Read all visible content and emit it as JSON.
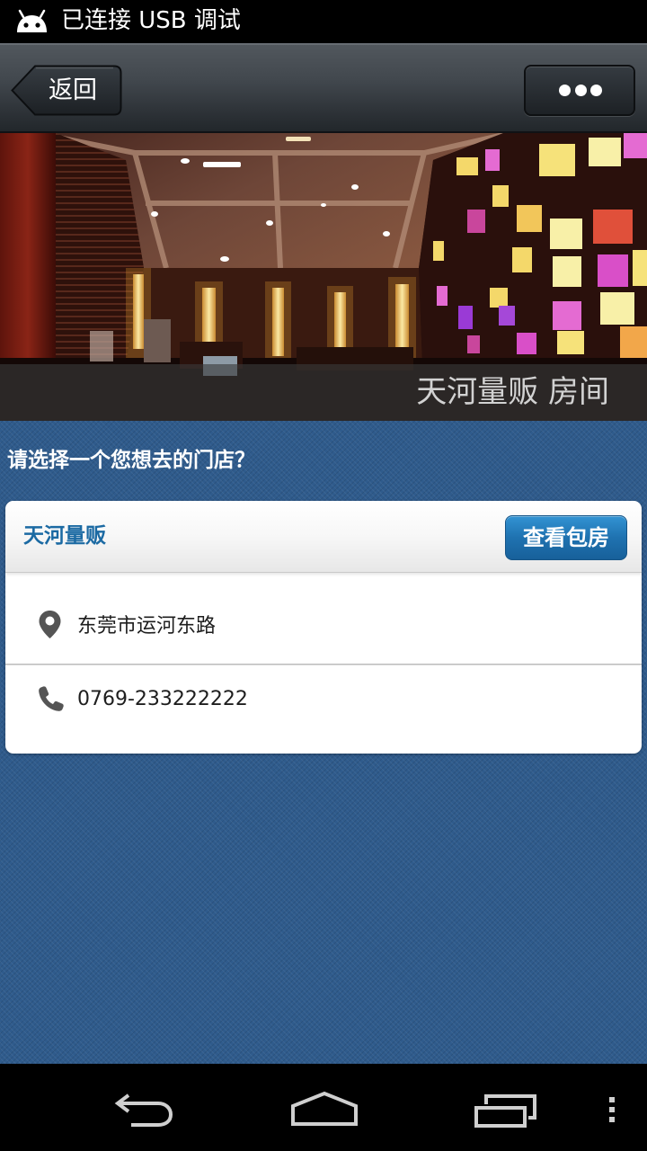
{
  "status_bar": {
    "icon": "android-debug-icon",
    "text": "已连接 USB 调试"
  },
  "header": {
    "back_label": "返回",
    "back_icon": "back-arrow-shape-icon",
    "more_icon": "more-dots-icon"
  },
  "banner": {
    "caption": "天河量贩 房间"
  },
  "prompt": "请选择一个您想去的门店？",
  "stores": [
    {
      "name": "天河量贩",
      "action_label": "查看包房",
      "address_icon": "location-pin-icon",
      "address": "东莞市运河东路",
      "phone_icon": "phone-icon",
      "phone": "0769-233222222"
    }
  ],
  "nav_bar": {
    "icons": [
      "back-icon",
      "home-icon",
      "recent-apps-icon",
      "overflow-menu-icon"
    ]
  },
  "colors": {
    "status_bar_bg": "#000000",
    "page_bg": "#2f5b8c",
    "card_bg": "#ffffff",
    "store_name": "#1b6aa3",
    "action_button": "#1f72b0"
  }
}
